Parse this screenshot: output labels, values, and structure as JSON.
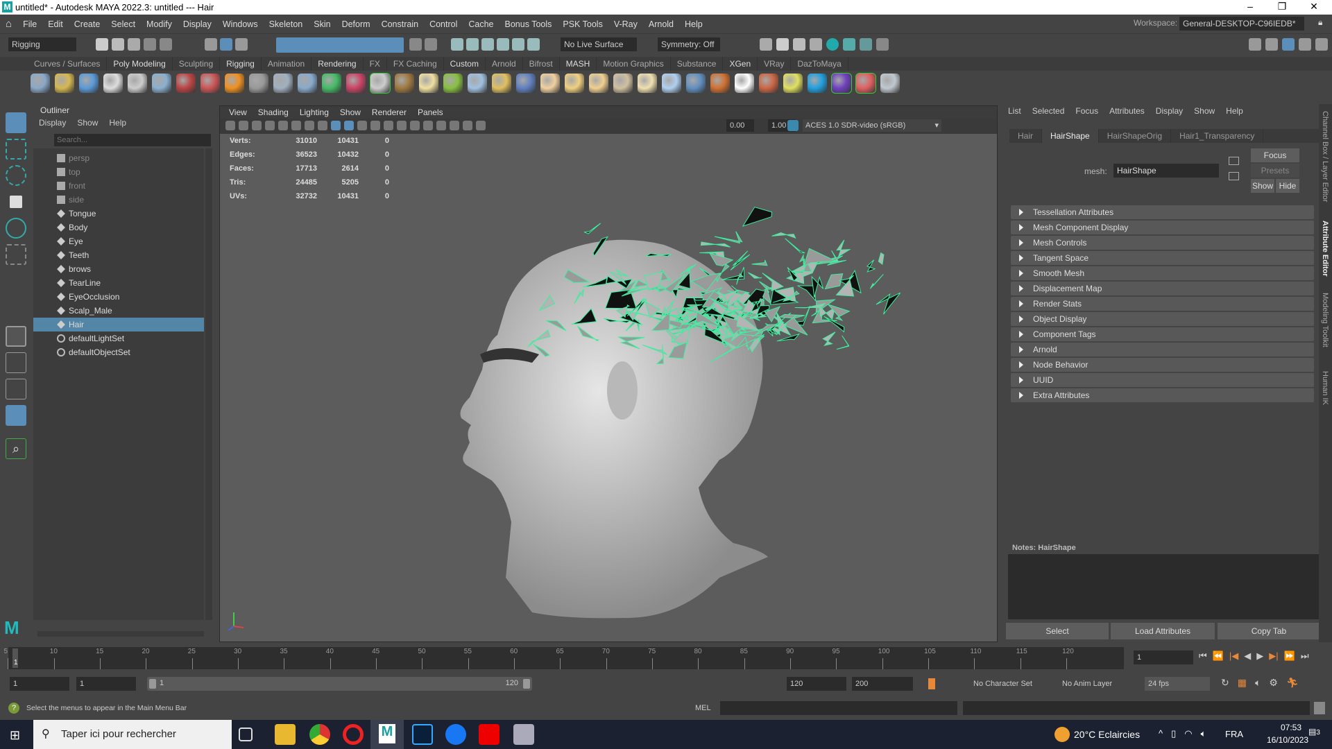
{
  "window": {
    "title": "untitled* - Autodesk MAYA 2022.3: untitled  ---  Hair",
    "minimize": "–",
    "maximize": "❐",
    "close": "✕"
  },
  "menu": [
    "File",
    "Edit",
    "Create",
    "Select",
    "Modify",
    "Display",
    "Windows",
    "Skeleton",
    "Skin",
    "Deform",
    "Constrain",
    "Control",
    "Cache",
    "Bonus Tools",
    "PSK Tools",
    "V-Ray",
    "Arnold",
    "Help"
  ],
  "workspace": {
    "label": "Workspace:",
    "value": "General-DESKTOP-C96IEDB*"
  },
  "statusline": {
    "menuset": "Rigging",
    "live_surface": "No Live Surface",
    "symmetry": "Symmetry: Off"
  },
  "shelf_tabs": [
    "Curves / Surfaces",
    "Poly Modeling",
    "Sculpting",
    "Rigging",
    "Animation",
    "Rendering",
    "FX",
    "FX Caching",
    "Custom",
    "Arnold",
    "Bifrost",
    "MASH",
    "Motion Graphics",
    "Substance",
    "XGen",
    "VRay",
    "DazToMaya"
  ],
  "shelf_icons": [
    [
      "bake-icon",
      "#8aa8c8"
    ],
    [
      "uv-icon",
      "#d6b850"
    ],
    [
      "hierarchy-icon",
      "#5a9ad8"
    ],
    [
      "plug-icon",
      "#dddddd"
    ],
    [
      "script-icon",
      "#cccccc"
    ],
    [
      "light-ball-icon",
      "#8ab0d0"
    ],
    [
      "camera-rig-icon",
      "#bb4444"
    ],
    [
      "spheres-icon",
      "#cc5555"
    ],
    [
      "fire-icon",
      "#f09020"
    ],
    [
      "lattice-icon",
      "#999999"
    ],
    [
      "shader-ball-icon",
      "#a0b0c0"
    ],
    [
      "cone-icon",
      "#88aacc"
    ],
    [
      "spot-light-icon",
      "#44bb66"
    ],
    [
      "rig-icon",
      "#cc4466"
    ],
    [
      "dome-icon",
      "#cccccc"
    ],
    [
      "texture-icon",
      "#a07840"
    ],
    [
      "globe-icon",
      "#f0e0a0"
    ],
    [
      "grass-icon",
      "#88c040"
    ],
    [
      "particles-icon",
      "#a0c0e0"
    ],
    [
      "curve-icon",
      "#e0c060"
    ],
    [
      "sphere-blue-icon",
      "#6080c0"
    ],
    [
      "dome-light-icon",
      "#f0d0a0"
    ],
    [
      "area-light-icon",
      "#f0d080"
    ],
    [
      "point-light-icon",
      "#f0d090"
    ],
    [
      "cone-light-icon",
      "#d0c0a0"
    ],
    [
      "sun-icon",
      "#f0e0b0"
    ],
    [
      "plane-icon",
      "#b0d0f0"
    ],
    [
      "sphere-icon",
      "#6090c0"
    ],
    [
      "material-icon",
      "#d07030"
    ],
    [
      "checker-icon",
      "#ffffff"
    ],
    [
      "frame-buffer-icon",
      "#cc6644"
    ],
    [
      "ipr-light-icon",
      "#e0e060"
    ],
    [
      "vray-cloud-icon",
      "#20a0e0"
    ],
    [
      "substance-icon",
      "#7040c0"
    ],
    [
      "color-balls-icon",
      "#e06060"
    ],
    [
      "help-icon",
      "#c0c8d0"
    ]
  ],
  "outliner": {
    "title": "Outliner",
    "menu": [
      "Display",
      "Show",
      "Help"
    ],
    "search_placeholder": "Search...",
    "items": [
      {
        "label": "persp",
        "type": "camera"
      },
      {
        "label": "top",
        "type": "camera"
      },
      {
        "label": "front",
        "type": "camera"
      },
      {
        "label": "side",
        "type": "camera"
      },
      {
        "label": "Tongue",
        "type": "mesh"
      },
      {
        "label": "Body",
        "type": "mesh"
      },
      {
        "label": "Eye",
        "type": "mesh"
      },
      {
        "label": "Teeth",
        "type": "mesh"
      },
      {
        "label": "brows",
        "type": "mesh"
      },
      {
        "label": "TearLine",
        "type": "mesh"
      },
      {
        "label": "EyeOcclusion",
        "type": "mesh"
      },
      {
        "label": "Scalp_Male",
        "type": "mesh"
      },
      {
        "label": "Hair",
        "type": "mesh",
        "selected": true
      },
      {
        "label": "defaultLightSet",
        "type": "set"
      },
      {
        "label": "defaultObjectSet",
        "type": "set"
      }
    ]
  },
  "viewport": {
    "menu": [
      "View",
      "Shading",
      "Lighting",
      "Show",
      "Renderer",
      "Panels"
    ],
    "exposure": "0.00",
    "gamma": "1.00",
    "colorspace": "ACES 1.0 SDR-video (sRGB)",
    "hud": [
      [
        "Verts:",
        "31010",
        "10431",
        "0"
      ],
      [
        "Edges:",
        "36523",
        "10432",
        "0"
      ],
      [
        "Faces:",
        "17713",
        "2614",
        "0"
      ],
      [
        "Tris:",
        "24485",
        "5205",
        "0"
      ],
      [
        "UVs:",
        "32732",
        "10431",
        "0"
      ]
    ]
  },
  "attribute_editor": {
    "menu": [
      "List",
      "Selected",
      "Focus",
      "Attributes",
      "Display",
      "Show",
      "Help"
    ],
    "tabs": [
      "Hair",
      "HairShape",
      "HairShapeOrig",
      "Hair1_Transparency"
    ],
    "active_tab": 1,
    "mesh_label": "mesh:",
    "mesh_value": "HairShape",
    "focus": "Focus",
    "presets": "Presets",
    "show": "Show",
    "hide": "Hide",
    "sections": [
      "Tessellation Attributes",
      "Mesh Component Display",
      "Mesh Controls",
      "Tangent Space",
      "Smooth Mesh",
      "Displacement Map",
      "Render Stats",
      "Object Display",
      "Component Tags",
      "Arnold",
      "Node Behavior",
      "UUID",
      "Extra Attributes"
    ],
    "notes_label": "Notes:  HairShape",
    "buttons": [
      "Select",
      "Load Attributes",
      "Copy Tab"
    ]
  },
  "side_tabs": [
    "Channel Box / Layer Editor",
    "Attribute Editor",
    "Modeling Toolkit",
    "Human IK"
  ],
  "timeline": {
    "ticks": [
      "5",
      "10",
      "15",
      "20",
      "25",
      "30",
      "35",
      "40",
      "45",
      "50",
      "55",
      "60",
      "65",
      "70",
      "75",
      "80",
      "85",
      "90",
      "95",
      "100",
      "105",
      "110",
      "115",
      "120"
    ],
    "current": "1",
    "current_field": "1"
  },
  "range": {
    "start": "1",
    "anim_start": "1",
    "slider_start": "1",
    "slider_end": "120",
    "anim_end": "120",
    "end": "200",
    "character_set": "No Character Set",
    "anim_layer": "No Anim Layer",
    "fps": "24 fps"
  },
  "command": {
    "lang": "MEL",
    "help": "Select the menus to appear in the Main Menu Bar"
  },
  "taskbar": {
    "search": "Taper ici pour rechercher",
    "weather": "20°C  Eclaircies",
    "lang": "FRA",
    "time": "07:53",
    "date": "16/10/2023",
    "notifications": "3"
  }
}
